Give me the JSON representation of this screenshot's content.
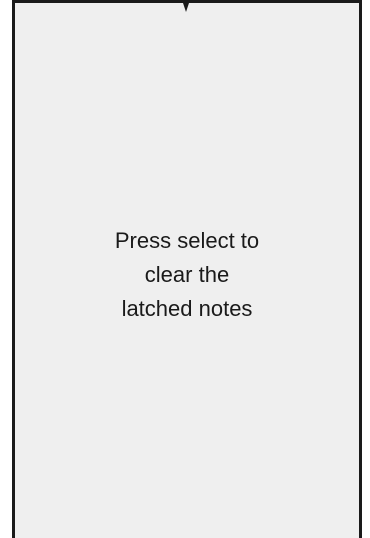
{
  "screen": {
    "message_lines": [
      "Press select to",
      "clear the",
      "latched notes"
    ],
    "colors": {
      "background": "#efefef",
      "border": "#1a1a1a",
      "text": "#1a1a1a"
    }
  },
  "indicator": {
    "icon": "down-pointer-icon"
  }
}
